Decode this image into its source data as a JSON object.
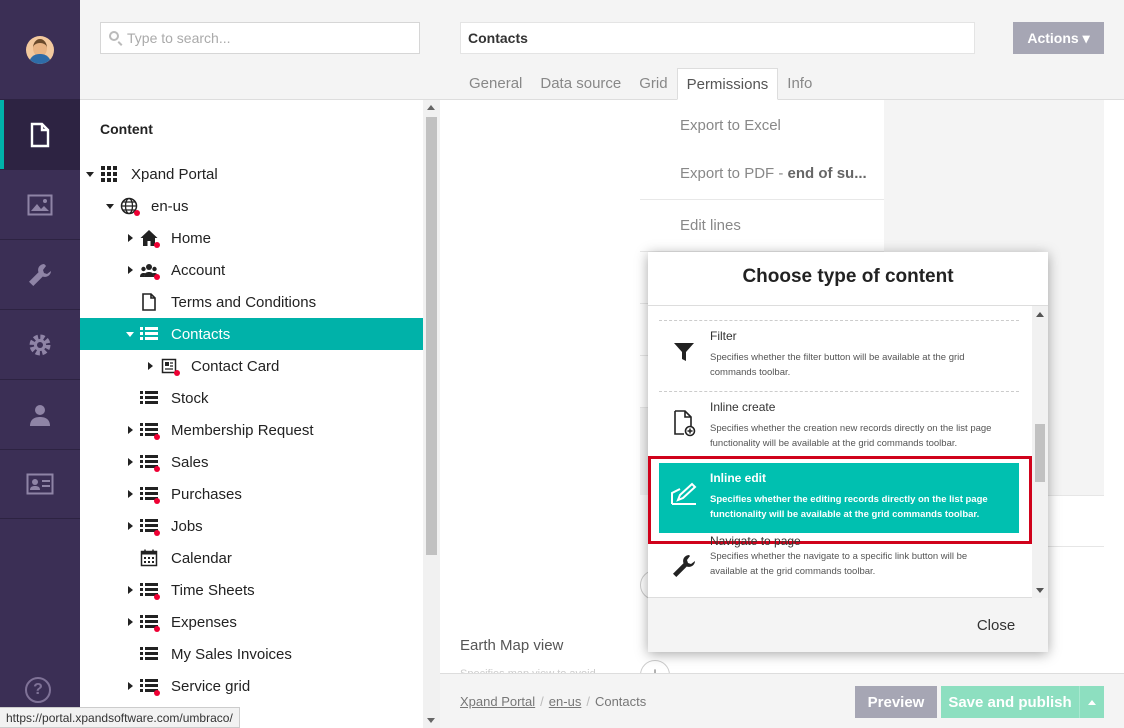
{
  "sections": {
    "items": [
      {
        "name": "content",
        "icon": "document-icon",
        "active": true
      },
      {
        "name": "media",
        "icon": "image-icon"
      },
      {
        "name": "developer",
        "icon": "wrench-icon"
      },
      {
        "name": "settings",
        "icon": "gear-icon"
      },
      {
        "name": "users",
        "icon": "user-icon"
      },
      {
        "name": "members",
        "icon": "id-card-icon"
      }
    ],
    "help_label": "?"
  },
  "tree": {
    "search_placeholder": "Type to search...",
    "heading": "Content",
    "nodes": [
      {
        "label": "Xpand Portal",
        "icon": "grid-icon",
        "caret": "down"
      },
      {
        "label": "en-us",
        "icon": "globe-icon",
        "caret": "down"
      },
      {
        "label": "Home",
        "icon": "home-icon",
        "caret": "right"
      },
      {
        "label": "Account",
        "icon": "users-icon",
        "caret": "right"
      },
      {
        "label": "Terms and Conditions",
        "icon": "page-icon",
        "caret": "none"
      },
      {
        "label": "Contacts",
        "icon": "list-icon",
        "caret": "down",
        "selected": true
      },
      {
        "label": "Contact Card",
        "icon": "card-icon",
        "caret": "right"
      },
      {
        "label": "Stock",
        "icon": "list-icon",
        "caret": "none"
      },
      {
        "label": "Membership Request",
        "icon": "list-icon",
        "caret": "right"
      },
      {
        "label": "Sales",
        "icon": "list-icon",
        "caret": "right"
      },
      {
        "label": "Purchases",
        "icon": "list-icon",
        "caret": "right"
      },
      {
        "label": "Jobs",
        "icon": "list-icon",
        "caret": "right"
      },
      {
        "label": "Calendar",
        "icon": "calendar-icon",
        "caret": "none"
      },
      {
        "label": "Time Sheets",
        "icon": "list-icon",
        "caret": "right"
      },
      {
        "label": "Expenses",
        "icon": "list-icon",
        "caret": "right"
      },
      {
        "label": "My Sales Invoices",
        "icon": "list-icon",
        "caret": "none"
      },
      {
        "label": "Service grid",
        "icon": "list-icon",
        "caret": "right"
      }
    ]
  },
  "editor": {
    "name_value": "Contacts",
    "actions_label": "Actions ▾",
    "tabs": [
      "General",
      "Data source",
      "Grid",
      "Permissions",
      "Info"
    ],
    "active_tab": "Permissions",
    "perm_rows": [
      {
        "text": "Export to Excel"
      },
      {
        "text": "Export to PDF - ",
        "bold": "end of su..."
      },
      {
        "text": "Edit lines"
      }
    ],
    "earth_title": "Earth Map view",
    "earth_desc": "Specifies map view to avoid...",
    "breadcrumb": [
      "Xpand Portal",
      "en-us",
      "Contacts"
    ],
    "preview_label": "Preview",
    "publish_label": "Save and publish"
  },
  "modal": {
    "title": "Choose type of content",
    "options": [
      {
        "name": "Filter",
        "desc": "Specifies whether the filter button will be available at the grid commands toolbar.",
        "icon": "funnel-icon"
      },
      {
        "name": "Inline create",
        "desc": "Specifies whether the creation new records directly on the list page functionality will be available at the grid commands toolbar.",
        "icon": "new-document-icon"
      },
      {
        "name": "Inline edit",
        "desc": "Specifies whether the editing records directly on the list page functionality will be available at the grid commands toolbar.",
        "icon": "edit-icon",
        "highlighted": true
      },
      {
        "name": "Navigate to page",
        "desc": "Specifies whether the navigate to a specific link button will be available at the grid commands toolbar.",
        "icon": "wrench-icon"
      }
    ],
    "close_label": "Close"
  },
  "status_url": "https://portal.xpandsoftware.com/umbraco/",
  "colors": {
    "accent": "#00b2a9",
    "sidebar": "#3b2f55",
    "highlight_border": "#d0021b"
  }
}
